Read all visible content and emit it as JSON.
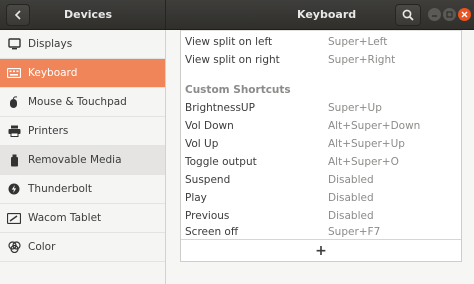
{
  "header": {
    "left_title": "Devices",
    "right_title": "Keyboard"
  },
  "sidebar": {
    "items": [
      {
        "label": "Displays",
        "icon": "display-icon"
      },
      {
        "label": "Keyboard",
        "icon": "keyboard-icon"
      },
      {
        "label": "Mouse & Touchpad",
        "icon": "mouse-icon"
      },
      {
        "label": "Printers",
        "icon": "printer-icon"
      },
      {
        "label": "Removable Media",
        "icon": "usb-drive-icon"
      },
      {
        "label": "Thunderbolt",
        "icon": "thunderbolt-icon"
      },
      {
        "label": "Wacom Tablet",
        "icon": "tablet-icon"
      },
      {
        "label": "Color",
        "icon": "color-icon"
      }
    ],
    "active_index": 1,
    "active_color": "#f0855a"
  },
  "shortcuts": {
    "top_rows": [
      {
        "name": "View split on left",
        "accel": "Super+Left"
      },
      {
        "name": "View split on right",
        "accel": "Super+Right"
      }
    ],
    "section_title": "Custom Shortcuts",
    "custom_rows": [
      {
        "name": "BrightnessUP",
        "accel": "Super+Up"
      },
      {
        "name": "Vol Down",
        "accel": "Alt+Super+Down"
      },
      {
        "name": "Vol Up",
        "accel": "Alt+Super+Up"
      },
      {
        "name": "Toggle output",
        "accel": "Alt+Super+O"
      },
      {
        "name": "Suspend",
        "accel": "Disabled"
      },
      {
        "name": "Play",
        "accel": "Disabled"
      },
      {
        "name": "Previous",
        "accel": "Disabled"
      },
      {
        "name": "Screen off",
        "accel": "Super+F7"
      }
    ],
    "add_label": "+"
  }
}
